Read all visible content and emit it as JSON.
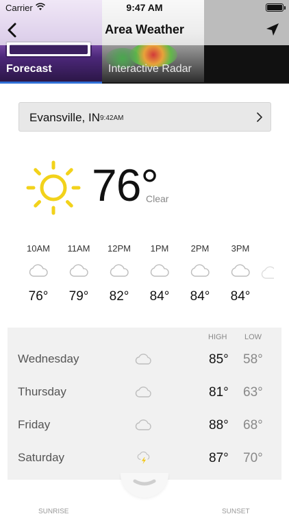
{
  "status_bar": {
    "carrier": "Carrier",
    "time": "9:47 AM"
  },
  "nav": {
    "title": "Area Weather",
    "back_icon": "chevron-left-icon",
    "locate_icon": "location-arrow-icon"
  },
  "tabs": [
    {
      "label": "Forecast",
      "selected": true
    },
    {
      "label": "Interactive Radar",
      "selected": false
    }
  ],
  "location": {
    "city": "Evansville, IN",
    "time": "9:42AM"
  },
  "current": {
    "temperature": "76°",
    "condition": "Clear",
    "icon": "sun-icon"
  },
  "hourly": [
    {
      "time": "10AM",
      "temp": "76°",
      "icon": "cloud-icon"
    },
    {
      "time": "11AM",
      "temp": "79°",
      "icon": "cloud-icon"
    },
    {
      "time": "12PM",
      "temp": "82°",
      "icon": "cloud-icon"
    },
    {
      "time": "1PM",
      "temp": "84°",
      "icon": "cloud-icon"
    },
    {
      "time": "2PM",
      "temp": "84°",
      "icon": "cloud-icon"
    },
    {
      "time": "3PM",
      "temp": "84°",
      "icon": "cloud-icon"
    }
  ],
  "daily": {
    "high_label": "HIGH",
    "low_label": "LOW",
    "days": [
      {
        "day": "Wednesday",
        "high": "85°",
        "low": "58°",
        "icon": "cloud-icon"
      },
      {
        "day": "Thursday",
        "high": "81°",
        "low": "63°",
        "icon": "cloud-icon"
      },
      {
        "day": "Friday",
        "high": "88°",
        "low": "68°",
        "icon": "cloud-icon"
      },
      {
        "day": "Saturday",
        "high": "87°",
        "low": "70°",
        "icon": "thunderstorm-icon"
      }
    ]
  },
  "footer": {
    "sunrise_label": "SUNRISE",
    "sunset_label": "SUNSET"
  },
  "colors": {
    "accent": "#2f6fd6",
    "sun": "#f2d21b",
    "bolt": "#f2c81b"
  }
}
